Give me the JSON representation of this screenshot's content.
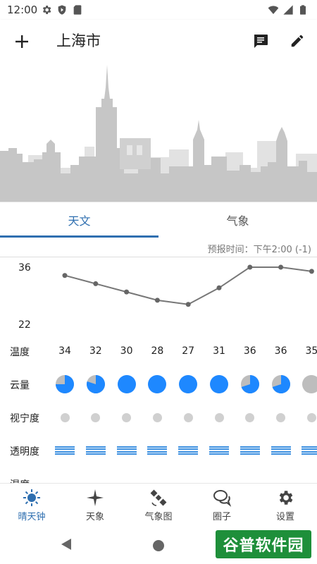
{
  "status_bar": {
    "time": "12:00"
  },
  "app_bar": {
    "title": "上海市"
  },
  "tabs": [
    {
      "label": "天文",
      "active": true
    },
    {
      "label": "气象",
      "active": false
    }
  ],
  "forecast_time": "预报时间：下午2:00 (-1)",
  "chart_data": {
    "type": "line",
    "y_max_label": "36",
    "y_min_label": "22",
    "ylim": [
      22,
      36
    ],
    "values": [
      34,
      32,
      30,
      28,
      27,
      31,
      36,
      36,
      35
    ]
  },
  "rows": {
    "temperature": {
      "label": "温度",
      "values": [
        "34",
        "32",
        "30",
        "28",
        "27",
        "31",
        "36",
        "36",
        "35"
      ]
    },
    "cloud": {
      "label": "云量",
      "fractions": [
        0.75,
        0.8,
        1.0,
        1.0,
        1.0,
        1.0,
        0.7,
        0.7,
        0.0
      ]
    },
    "seeing": {
      "label": "视宁度"
    },
    "transparency": {
      "label": "透明度"
    },
    "humidity": {
      "label": "湿度"
    }
  },
  "colors": {
    "accent": "#2f6fb0",
    "cloud_blue": "#1e88ff",
    "cloud_gray": "#bdbdbd"
  },
  "bottom_nav": [
    {
      "label": "晴天钟",
      "icon": "sun-icon",
      "active": true
    },
    {
      "label": "天象",
      "icon": "star-sparkle-icon",
      "active": false
    },
    {
      "label": "气象图",
      "icon": "satellite-icon",
      "active": false
    },
    {
      "label": "圈子",
      "icon": "chat-bubbles-icon",
      "active": false
    },
    {
      "label": "设置",
      "icon": "gear-icon",
      "active": false
    }
  ],
  "watermark": "谷普软件园"
}
